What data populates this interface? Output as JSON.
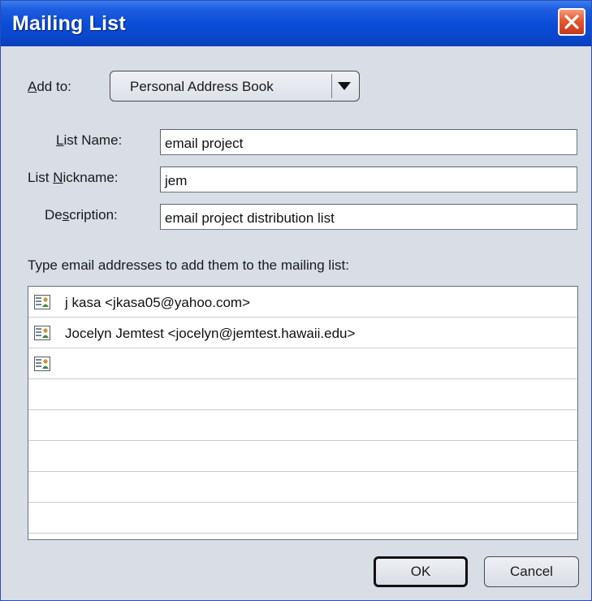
{
  "window": {
    "title": "Mailing List",
    "close_icon": "close-x-icon"
  },
  "add_to": {
    "label_accel": "A",
    "label_rest": "dd to:",
    "selected": "Personal Address Book",
    "arrow_icon": "dropdown-arrow-icon"
  },
  "fields": {
    "list_name": {
      "label_accel": "L",
      "label_rest": "ist Name:",
      "value": "email project"
    },
    "list_nickname": {
      "label_pre": "List ",
      "label_accel": "N",
      "label_rest": "ickname:",
      "value": "jem"
    },
    "description": {
      "label_pre": "De",
      "label_accel": "s",
      "label_rest": "cription:",
      "value": "email project distribution list"
    }
  },
  "instructions": "Type email addresses to add them to the mailing list:",
  "members": [
    {
      "text": "j kasa <jkasa05@yahoo.com>",
      "icon": "address-card-icon"
    },
    {
      "text": "Jocelyn Jemtest <jocelyn@jemtest.hawaii.edu>",
      "icon": "address-card-icon"
    },
    {
      "text": "",
      "icon": "address-card-icon"
    }
  ],
  "buttons": {
    "ok": "OK",
    "cancel": "Cancel"
  },
  "colors": {
    "titlebar": "#0a4dd8",
    "dialog_bg": "#d8dde6",
    "close_button": "#e4572e"
  }
}
